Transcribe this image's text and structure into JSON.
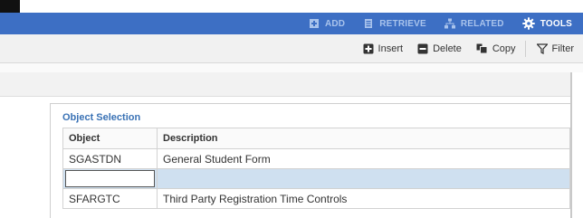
{
  "topnav": {
    "items": [
      {
        "label": "ADD",
        "icon": "add-icon"
      },
      {
        "label": "RETRIEVE",
        "icon": "retrieve-icon"
      },
      {
        "label": "RELATED",
        "icon": "related-icon"
      },
      {
        "label": "TOOLS",
        "icon": "gear-icon"
      }
    ]
  },
  "toolbar": {
    "insert_label": "Insert",
    "delete_label": "Delete",
    "copy_label": "Copy",
    "filter_label": "Filter"
  },
  "section": {
    "title": "Object Selection"
  },
  "table": {
    "headers": [
      "Object",
      "Description"
    ],
    "rows": [
      {
        "object": "SGASTDN",
        "description": "General Student Form"
      },
      {
        "object": "",
        "description": ""
      },
      {
        "object": "SFARGTC",
        "description": "Third Party Registration Time Controls"
      }
    ]
  },
  "colors": {
    "nav_bar": "#3d6fc4",
    "nav_inactive_text": "#a9c3ec",
    "section_title": "#3a72b5",
    "selected_row": "#cfe0f0"
  }
}
